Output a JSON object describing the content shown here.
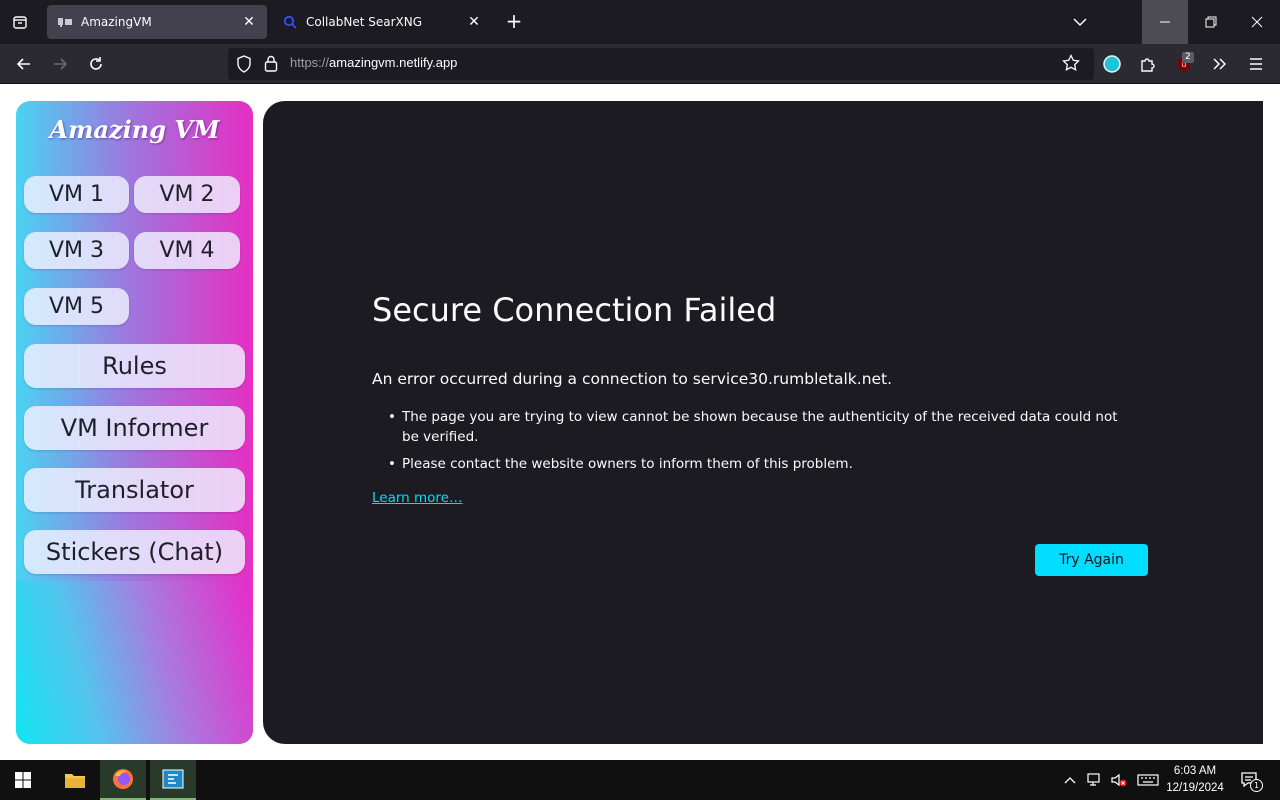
{
  "browser": {
    "tabs": [
      {
        "title": "AmazingVM",
        "icon": "amazingvm-favicon",
        "active": true
      },
      {
        "title": "CollabNet SearXNG",
        "icon": "search-icon",
        "active": false
      }
    ],
    "url_protocol": "https://",
    "url_host": "amazingvm.netlify.app",
    "ublock_badge": "2"
  },
  "sidebar": {
    "brand": "Amazing VM",
    "vm_buttons": [
      "VM 1",
      "VM 2",
      "VM 3",
      "VM 4",
      "VM 5"
    ],
    "nav_buttons": [
      "Rules",
      "VM Informer",
      "Translator",
      "Stickers (Chat)"
    ]
  },
  "error": {
    "title": "Secure Connection Failed",
    "description": "An error occurred during a connection to service30.rumbletalk.net.",
    "items": [
      "The page you are trying to view cannot be shown because the authenticity of the received data could not be verified.",
      "Please contact the website owners to inform them of this problem."
    ],
    "learn_more": "Learn more…",
    "try_again": "Try Again"
  },
  "taskbar": {
    "time": "6:03 AM",
    "date": "12/19/2024",
    "notification_count": "1"
  },
  "colors": {
    "accent": "#00ddff",
    "panel_bg": "#1c1b22",
    "chrome_bg": "#2b2a33"
  }
}
